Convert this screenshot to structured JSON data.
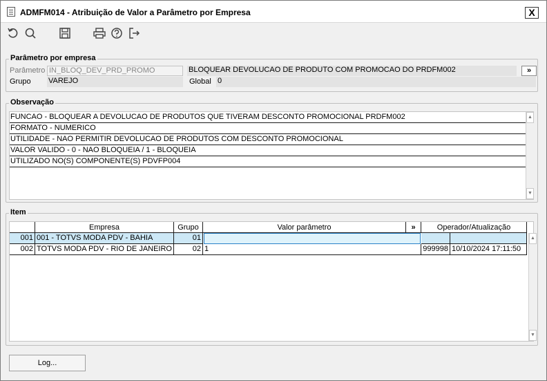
{
  "window": {
    "title": "ADMFM014 - Atribuição de Valor a Parâmetro por Empresa",
    "close_label": "X"
  },
  "toolbar": {
    "icons": [
      "undo-icon",
      "search-icon",
      "save-icon",
      "print-icon",
      "help-icon",
      "exit-icon"
    ]
  },
  "parametro_section": {
    "legend": "Parâmetro por empresa",
    "parametro_label": "Parâmetro",
    "parametro_value": "IN_BLOQ_DEV_PRD_PROMO",
    "descricao_value": "BLOQUEAR DEVOLUCAO DE PRODUTO COM PROMOCAO DO PRDFM002",
    "expand_label": "»",
    "grupo_label": "Grupo",
    "grupo_value": "VAREJO",
    "global_label": "Global",
    "global_value": "0"
  },
  "observacao_section": {
    "legend": "Observação",
    "lines": [
      "FUNCAO - BLOQUEAR A DEVOLUCAO DE PRODUTOS QUE TIVERAM DESCONTO PROMOCIONAL PRDFM002",
      "FORMATO - NUMERICO",
      "UTILIDADE - NAO PERMITIR DEVOLUCAO DE PRODUTOS COM DESCONTO PROMOCIONAL",
      "VALOR VALIDO - 0 - NAO BLOQUEIA / 1 - BLOQUEIA",
      "UTILIZADO NO(S) COMPONENTE(S) PDVFP004"
    ]
  },
  "item_section": {
    "legend": "Item",
    "columns": {
      "empresa": "Empresa",
      "grupo": "Grupo",
      "valor": "Valor parâmetro",
      "expand": "»",
      "operador": "Operador/Atualização"
    },
    "rows": [
      {
        "num": "001",
        "empresa": "001 - TOTVS MODA PDV - BAHIA",
        "grupo": "01",
        "valor": "",
        "operador": "",
        "atualizacao": ""
      },
      {
        "num": "002",
        "empresa": "TOTVS MODA PDV - RIO DE JANEIRO - NO",
        "grupo": "02",
        "valor": "1",
        "operador": "999998",
        "atualizacao": "10/10/2024 17:11:50"
      }
    ]
  },
  "footer": {
    "log_label": "Log..."
  },
  "colors": {
    "selected_row": "#cde8f6",
    "edit_border": "#2a82c8",
    "window_bg": "#f0f0f0"
  }
}
